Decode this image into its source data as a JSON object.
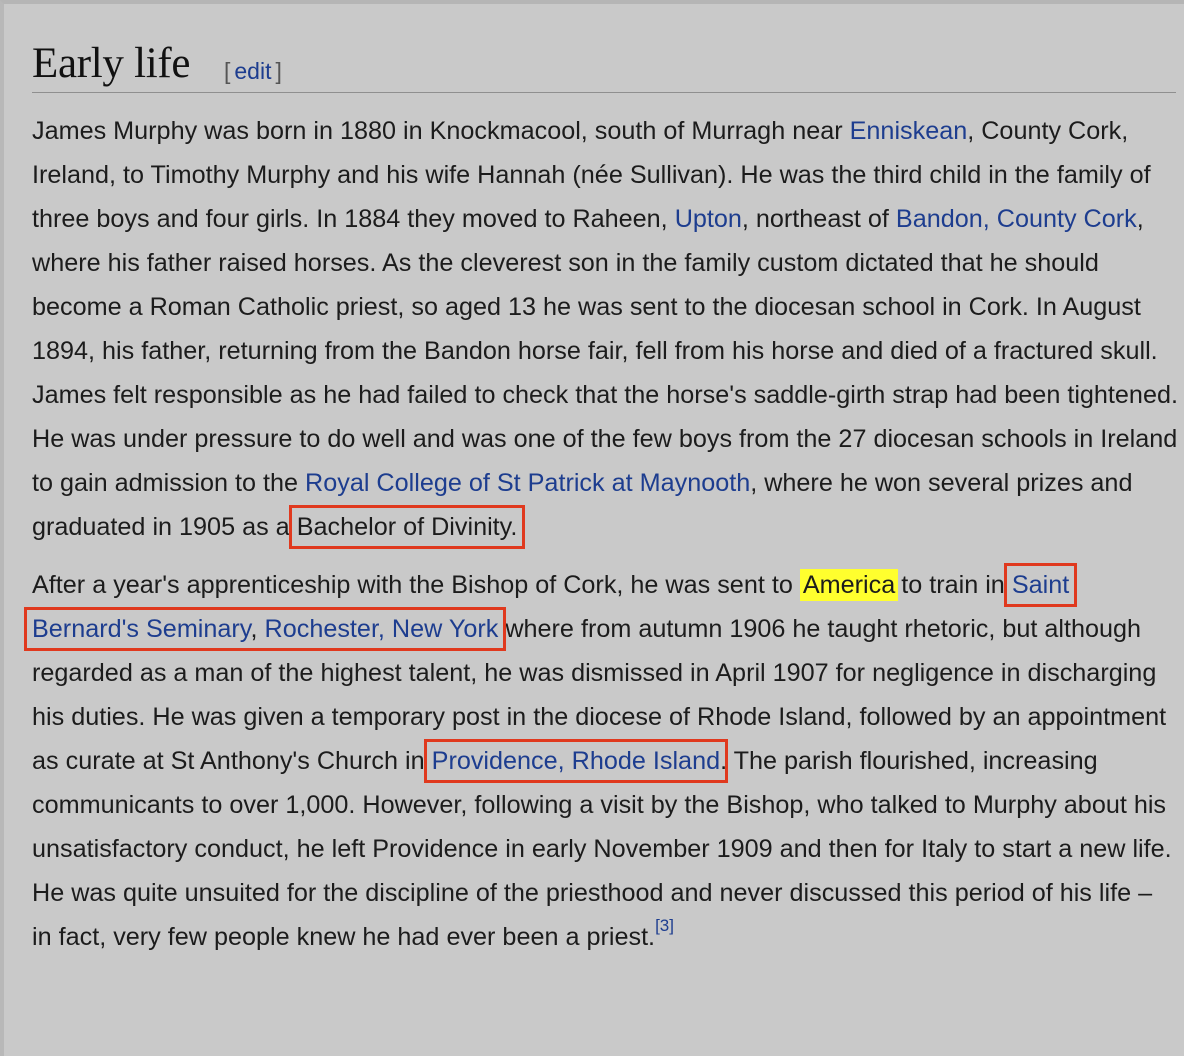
{
  "section": {
    "title": "Early life",
    "edit_open": "[",
    "edit_label": "edit",
    "edit_close": "]"
  },
  "para1": {
    "t1": "James Murphy was born in 1880 in Knockmacool, south of Murragh near ",
    "l1": "Enniskean",
    "t2": ", County Cork, Ireland, to Timothy Murphy and his wife Hannah (née Sullivan). He was the third child in the family of three boys and four girls. In 1884 they moved to Raheen, ",
    "l2": "Upton",
    "t3": ", northeast of ",
    "l3": "Bandon, County Cork",
    "t4": ", where his father raised horses. As the cleverest son in the family custom dictated that he should become a Roman Catholic priest, so aged 13 he was sent to the diocesan school in Cork. In August 1894, his father, returning from the Bandon horse fair, fell from his horse and died of a fractured skull. James felt responsible as he had failed to check that the horse's saddle-girth strap had been tightened. He was under pressure to do well and was one of the few boys from the 27 diocesan schools in Ireland to gain admission to the ",
    "l4": "Royal College of St Patrick at Maynooth",
    "t5": ", where he won several prizes and graduated in 1905 as a ",
    "boxed": "Bachelor of Divinity."
  },
  "para2": {
    "t1": "After a year's apprenticeship with the Bishop of Cork, he was sent to ",
    "highlight": "America",
    "t2": "to train in ",
    "l1": "Saint Bernard's Seminary",
    "sep": ", ",
    "l2": "Rochester, New York",
    "t3": " where from autumn 1906 he taught rhetoric, but although regarded as a man of the highest talent, he was dismissed in April 1907 for negligence in discharging his duties. He was given a temporary post in the diocese of Rhode Island, followed by an appointment as curate at St Anthony's Church in ",
    "l3": "Providence, Rhode Island",
    "t4": ". The parish flourished, increasing communicants to over 1,000. However, following a visit by the Bishop, who talked to Murphy about his unsatisfactory conduct, he left Providence in early November 1909 and then for Italy to start a new life. He was quite unsuited for the discipline of the priesthood and never discussed this period of his life – in fact, very few people knew he had ever been a priest.",
    "ref": "[3]"
  },
  "colors": {
    "link": "#1d3d8f",
    "highlight": "#ffff2e",
    "box": "#e0391e"
  }
}
